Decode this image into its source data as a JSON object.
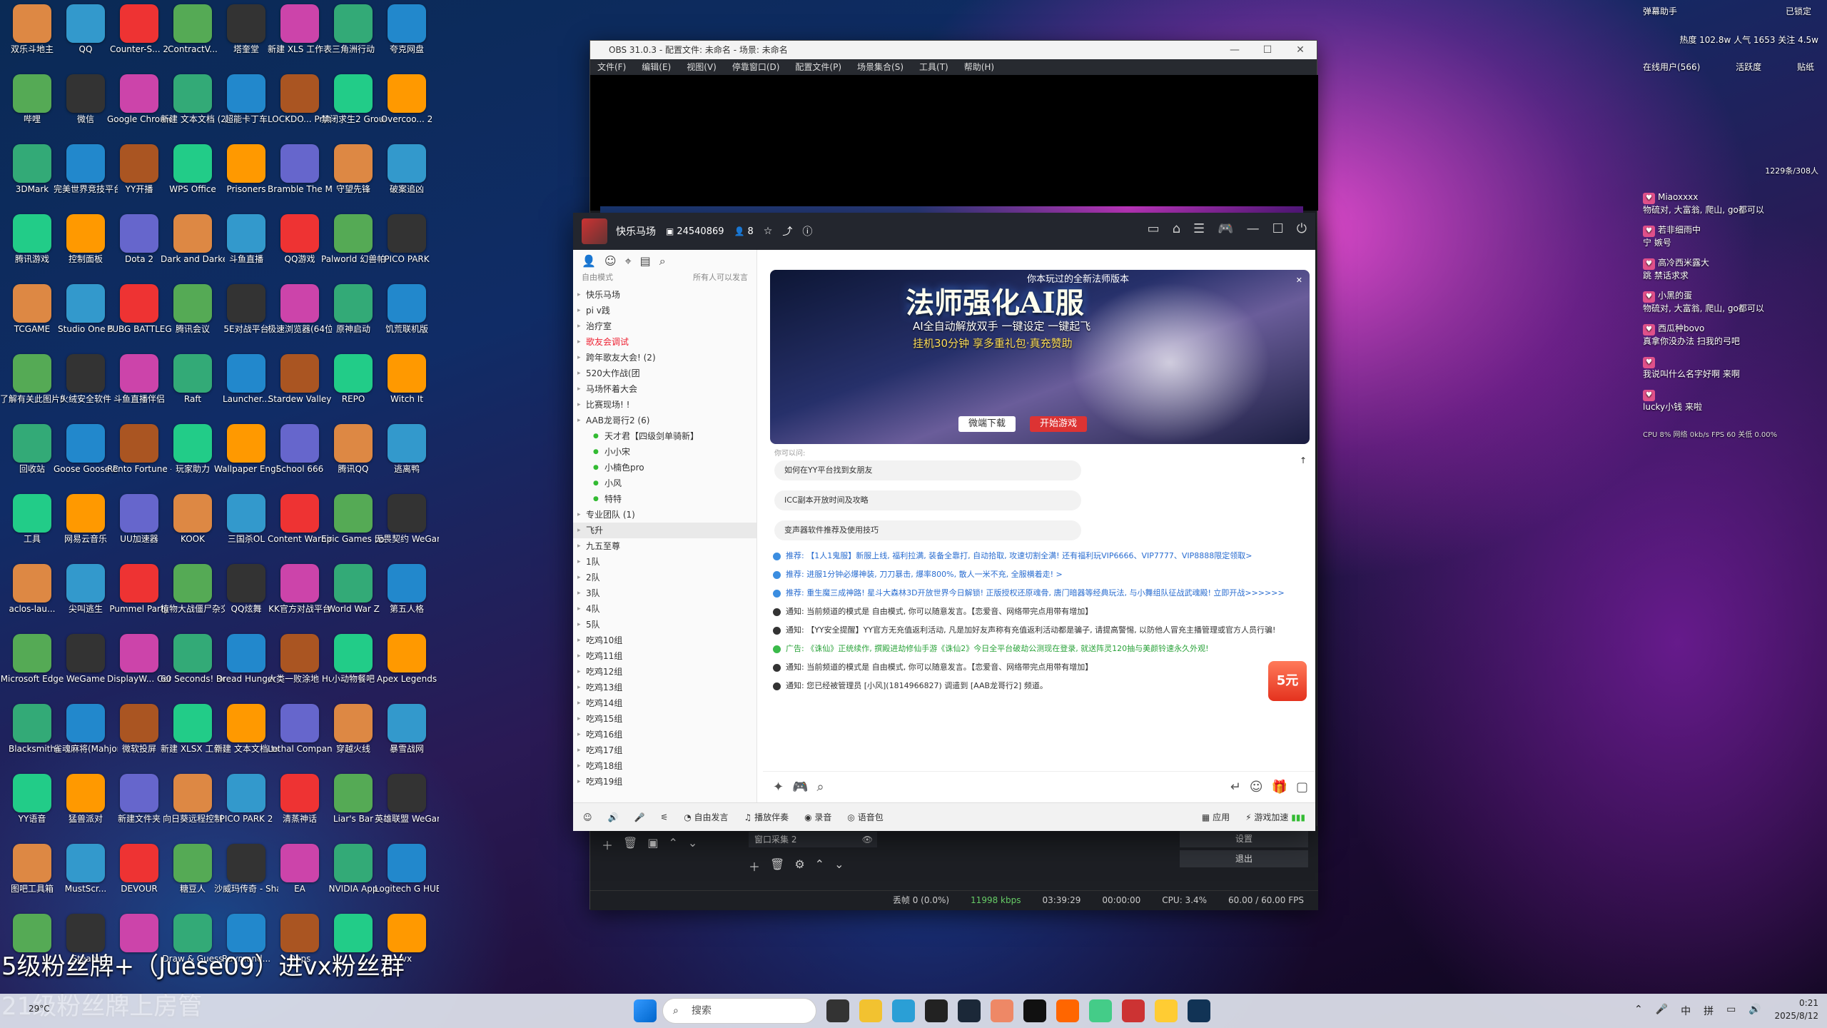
{
  "desktop_icons": [
    [
      "双乐斗地主",
      "QQ",
      "Counter-S... 2",
      "ContractV...",
      "塔奎堂",
      "新建 XLS 工作表.xls",
      "三角洲行动",
      "夸克网盘"
    ],
    [
      "哔哩",
      "微信",
      "Google Chrome",
      "新建 文本文档 (2).txt",
      "超能卡丁车",
      "LOCKDO... Protocol",
      "禁闭求生2 Grounded 2",
      "Overcoo... 2"
    ],
    [
      "3DMark",
      "完美世界竞技平台",
      "YY开播",
      "WPS Office",
      "Prisoners",
      "Bramble The Mo...",
      "守望先锋",
      "破案追凶"
    ],
    [
      "腾讯游戏",
      "控制面板",
      "Dota 2",
      "Dark and Darker",
      "斗鱼直播",
      "QQ游戏",
      "Palworld 幻兽帕鲁",
      "PICO PARK"
    ],
    [
      "TCGAME",
      "Studio One 5",
      "PUBG BATTLEGR...",
      "腾讯会议",
      "5E对战平台",
      "极速浏览器(64位)",
      "原神启动",
      "饥荒联机版"
    ],
    [
      "了解有关此图片的信息",
      "火绒安全软件",
      "斗鱼直播伴侣",
      "Raft",
      "Launcher...",
      "Stardew Valley",
      "REPO",
      "Witch It"
    ],
    [
      "回收站",
      "Goose Goose Duck",
      "Rento Fortune -...",
      "玩家助力",
      "Wallpaper Engine:...",
      "School 666",
      "腾讯QQ",
      "逃离鸭"
    ],
    [
      "工具",
      "网易云音乐",
      "UU加速器",
      "KOOK",
      "三国杀OL",
      "Content Warning",
      "Epic Games Launcher",
      "无畏契约 WeGame版"
    ],
    [
      "aclos-lau...",
      "尖叫逃生",
      "Pummel Party",
      "植物大战僵尸杂交版",
      "QQ炫舞",
      "KK官方对战平台",
      "World War Z",
      "第五人格"
    ],
    [
      "Microsoft Edge",
      "WeGame",
      "DisplayW... Center",
      "60 Seconds! Reatomized",
      "Dread Hunger",
      "人类一败涂地 Hum...",
      "小动物餐吧",
      "Apex Legends"
    ],
    [
      "Blacksmith",
      "雀魂麻将(Mahjong...",
      "微软投屏",
      "新建 XLSX 工作表.xlsx",
      "新建 文本文档.txt",
      "Lethal Company",
      "穿越火线",
      "暴雪战网"
    ],
    [
      "YY语音",
      "猛兽派对",
      "新建文件夹",
      "向日葵远程控制",
      "PICO PARK 2",
      "清蒸神话",
      "Liar's Bar",
      "英雄联盟 WeGame版"
    ],
    [
      "图吧工具箱",
      "MustScr...",
      "DEVOUR",
      "糖豆人",
      "沙威玛传奇 - Shawarma...",
      "EA",
      "NVIDIA App",
      "Logitech G HUB"
    ],
    [
      "",
      "Steam",
      "",
      "Draw & Guess",
      "Raymond...",
      "Oops",
      "",
      "vx"
    ]
  ],
  "icon_colors": [
    "#d84",
    "#39c",
    "#e33",
    "#5a5",
    "#333",
    "#c4a",
    "#3a7",
    "#28c",
    "#a52",
    "#2c8",
    "#f90",
    "#66c"
  ],
  "obs": {
    "title": "OBS 31.0.3 - 配置文件: 未命名 - 场景: 未命名",
    "menu": [
      "文件(F)",
      "编辑(E)",
      "视图(V)",
      "停靠窗口(D)",
      "配置文件(P)",
      "场景集合(S)",
      "工具(T)",
      "帮助(H)"
    ],
    "source": "窗口采集 2",
    "settings": "设置",
    "exit": "退出",
    "status": [
      "丢帧 0 (0.0%)",
      "11998 kbps",
      "03:39:29",
      "00:00:00",
      "CPU: 3.4%",
      "60.00 / 60.00 FPS"
    ]
  },
  "yy": {
    "channel_name": "快乐马场",
    "room_id": "24540869",
    "fans": "8",
    "mode": "自由模式",
    "mode_right": "所有人可以发言",
    "channels": [
      {
        "name": "快乐马场",
        "style": ""
      },
      {
        "name": "pi v践",
        "style": ""
      },
      {
        "name": "治疗室",
        "style": ""
      },
      {
        "name": "歌友会调试",
        "style": "red"
      },
      {
        "name": "跨年歌友大会! (2)",
        "style": ""
      },
      {
        "name": "520大作战(团",
        "style": ""
      },
      {
        "name": "马场怀着大会",
        "style": ""
      },
      {
        "name": "比赛现场! !",
        "style": ""
      },
      {
        "name": "AAB龙哥行2 (6)",
        "style": ""
      },
      {
        "name": "天才君【四级剑单骑新】",
        "style": "sub"
      },
      {
        "name": "小小宋",
        "style": "sub"
      },
      {
        "name": "小楠色pro",
        "style": "sub"
      },
      {
        "name": "小风",
        "style": "sub"
      },
      {
        "name": "特特",
        "style": "sub"
      },
      {
        "name": "专业团队 (1)",
        "style": ""
      },
      {
        "name": "飞升",
        "style": "sel"
      },
      {
        "name": "九五至尊",
        "style": ""
      },
      {
        "name": "1队",
        "style": ""
      },
      {
        "name": "2队",
        "style": ""
      },
      {
        "name": "3队",
        "style": ""
      },
      {
        "name": "4队",
        "style": ""
      },
      {
        "name": "5队",
        "style": ""
      },
      {
        "name": "吃鸡10组",
        "style": ""
      },
      {
        "name": "吃鸡11组",
        "style": ""
      },
      {
        "name": "吃鸡12组",
        "style": ""
      },
      {
        "name": "吃鸡13组",
        "style": ""
      },
      {
        "name": "吃鸡14组",
        "style": ""
      },
      {
        "name": "吃鸡15组",
        "style": ""
      },
      {
        "name": "吃鸡16组",
        "style": ""
      },
      {
        "name": "吃鸡17组",
        "style": ""
      },
      {
        "name": "吃鸡18组",
        "style": ""
      },
      {
        "name": "吃鸡19组",
        "style": ""
      }
    ],
    "ad": {
      "top": "你本玩过的全新法师版本",
      "title": "法师强化AI服",
      "line1": "AI全自动解放双手 一键设定 一键起飞",
      "line2": "挂机30分钟 享多重礼包·真充赞助",
      "btn1": "微端下载",
      "btn2": "开始游戏"
    },
    "chat_hint": "你可以问:",
    "faqs": [
      "如何在YY平台找到女朋友",
      "ICC副本开放时间及攻略",
      "变声器软件推荐及使用技巧"
    ],
    "messages": [
      {
        "type": "blue",
        "text": "推荐: 【1人1鬼服】新服上线, 福利拉满, 装备全靠打, 自动拾取, 攻速切割全满! 还有福利玩VIP6666、VIP7777、VIP8888限定领取>"
      },
      {
        "type": "blue",
        "text": "推荐: 进服1分钟必爆神装, 刀刀暴击, 爆率800%, 散人一米不充, 全服横着走! >"
      },
      {
        "type": "blue",
        "text": "推荐: 重生魔三成神路! 星斗大森林3D开放世界今日解锁! 正版授权还原魂骨, 唐门暗器等经典玩法, 与小舞组队征战武魂殿! 立即开战>>>>>>"
      },
      {
        "type": "",
        "text": "通知: 当前频道的模式是 自由模式, 你可以随意发言。【恋爱音、网络带完点用带有增加】"
      },
      {
        "type": "",
        "text": "通知: 【YY安全提醒】YY官方无充值返利活动, 凡是加好友声称有充值返利活动都是骗子, 请提高警惕, 以防他人冒充主播管理或官方人员行骗!"
      },
      {
        "type": "green",
        "text": "广告: 《诛仙》正统续作, 撰殿进劫修仙手游《诛仙2》今日全平台破劫公测现在登录, 就送阵灵120抽与美颜铃速永久外观!"
      },
      {
        "type": "",
        "text": "通知: 当前频道的模式是 自由模式, 你可以随意发言。【恋爱音、网络带完点用带有增加】"
      },
      {
        "type": "",
        "text": "通知: 您已经被管理员 [小风](1814966827) 调遣到 [AAB龙哥行2] 频道。"
      }
    ],
    "bottom": [
      "自由发言",
      "播放伴奏",
      "录音",
      "语音包",
      "应用",
      "游戏加速"
    ],
    "promo": "5元"
  },
  "danmu": {
    "title": "弹幕助手",
    "status": "已锁定",
    "stats": "热度 102.8w  人气 1653  关注 4.5w",
    "tabs": [
      "在线用户(566)",
      "活跃度",
      "贴纸"
    ],
    "count": "1229条/308人",
    "items": [
      {
        "name": "Miaoxxxx",
        "text": "物硫对, 大富翁, 爬山, go都可以"
      },
      {
        "name": "若非细雨中",
        "text": "宁 嫉号"
      },
      {
        "name": "高冷西米露大",
        "text": "跳 禁话求求"
      },
      {
        "name": "小黑的蛋",
        "text": "物硫对, 大富翁, 爬山, go都可以"
      },
      {
        "name": "西瓜种bovo",
        "text": "真拿你没办法 扫我的弓吧"
      },
      {
        "name": "",
        "text": "我说叫什么名字好啊 来啊"
      },
      {
        "name": "",
        "text": "lucky小钱 来啦"
      }
    ],
    "footer": "CPU 8%  网络 0kb/s  FPS 60  关低 0.00%"
  },
  "overlay": {
    "line1": "5级粉丝牌+（Juese09）进vx粉丝群",
    "line2": "21级粉丝牌上房管"
  },
  "taskbar": {
    "search": "搜索",
    "ime1": "中",
    "ime2": "拼",
    "time": "0:21",
    "date": "2025/8/12",
    "weather": "29°C"
  }
}
